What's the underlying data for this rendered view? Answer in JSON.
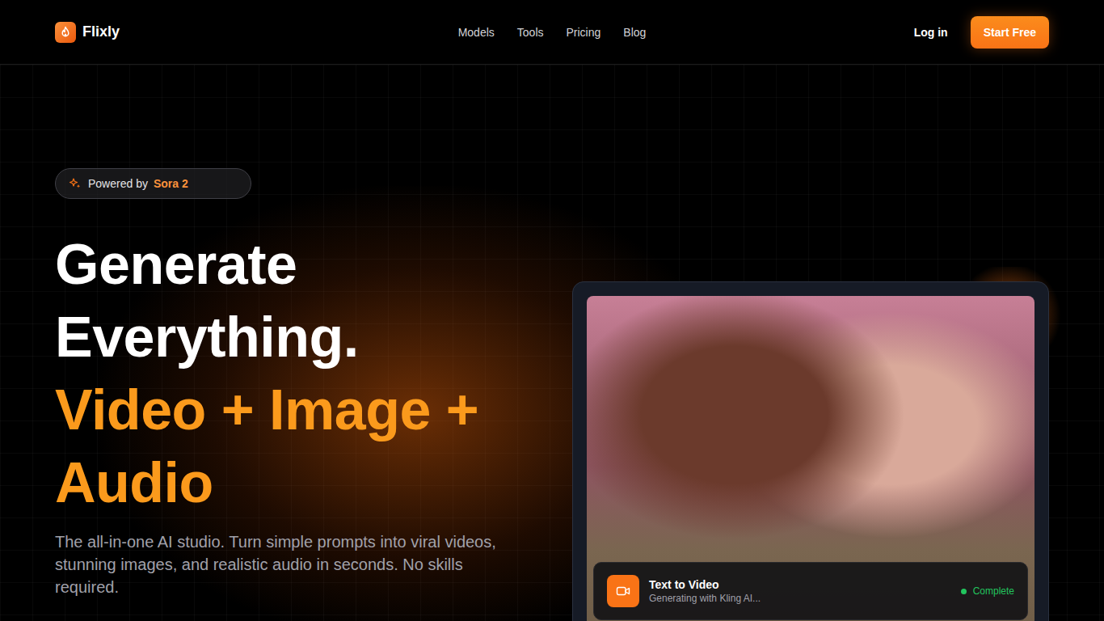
{
  "nav": {
    "brand": "Flixly",
    "links": [
      "Models",
      "Tools",
      "Pricing",
      "Blog"
    ],
    "login": "Log in",
    "cta": "Start Free"
  },
  "badge": {
    "prefix": "Powered by",
    "model": "Sora 2"
  },
  "headline": [
    {
      "text": "Generate",
      "highlighted": false
    },
    {
      "text": "Everything.",
      "highlighted": false
    },
    {
      "text": "Video + Image +",
      "highlighted": true
    },
    {
      "text": "Audio",
      "highlighted": true
    }
  ],
  "subtitle": "The all-in-one AI studio. Turn simple prompts into viral videos, stunning images, and realistic audio in seconds. No skills required.",
  "preview": {
    "task": "Text to Video",
    "detail": "Generating with Kling AI...",
    "status": "Complete",
    "color": "#22c55e"
  }
}
